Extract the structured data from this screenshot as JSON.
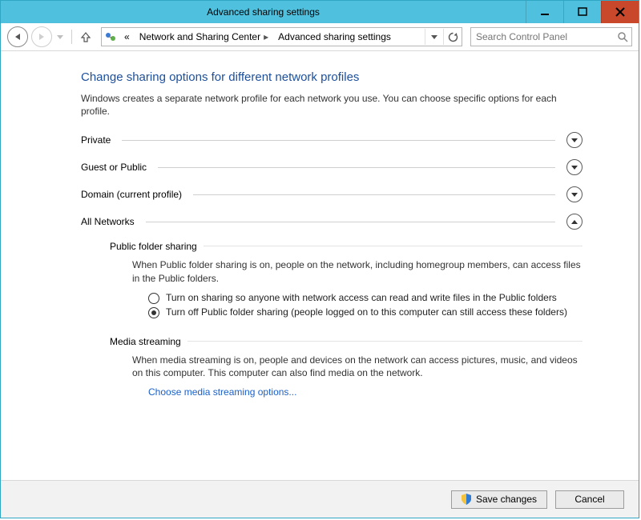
{
  "window": {
    "title": "Advanced sharing settings"
  },
  "breadcrumb": {
    "prefix": "«",
    "parent": "Network and Sharing Center",
    "current": "Advanced sharing settings"
  },
  "search": {
    "placeholder": "Search Control Panel"
  },
  "page": {
    "heading": "Change sharing options for different network profiles",
    "intro": "Windows creates a separate network profile for each network you use. You can choose specific options for each profile."
  },
  "profiles": {
    "private": {
      "label": "Private"
    },
    "guest": {
      "label": "Guest or Public"
    },
    "domain": {
      "label": "Domain (current profile)"
    },
    "all": {
      "label": "All Networks"
    }
  },
  "publicFolder": {
    "heading": "Public folder sharing",
    "desc": "When Public folder sharing is on, people on the network, including homegroup members, can access files in the Public folders.",
    "optOn": "Turn on sharing so anyone with network access can read and write files in the Public folders",
    "optOff": "Turn off Public folder sharing (people logged on to this computer can still access these folders)"
  },
  "media": {
    "heading": "Media streaming",
    "desc": "When media streaming is on, people and devices on the network can access pictures, music, and videos on this computer. This computer can also find media on the network.",
    "link": "Choose media streaming options..."
  },
  "buttons": {
    "save": "Save changes",
    "cancel": "Cancel"
  }
}
